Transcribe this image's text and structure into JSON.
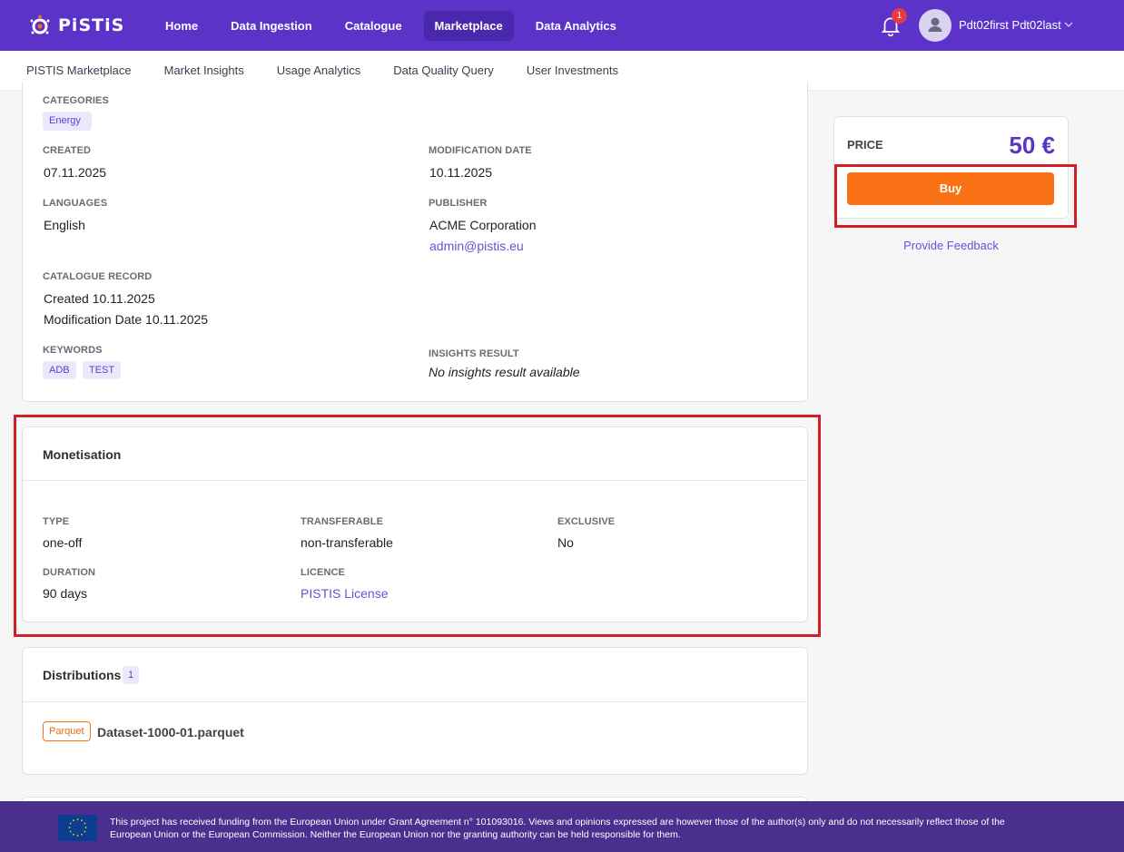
{
  "app": {
    "logo_text": "PiSTiS",
    "nav": [
      "Home",
      "Data Ingestion",
      "Catalogue",
      "Marketplace",
      "Data Analytics"
    ],
    "active_nav": "Marketplace",
    "notifications_count": "1",
    "username": "Pdt02first Pdt02last"
  },
  "subnav": [
    "PISTIS Marketplace",
    "Market Insights",
    "Usage Analytics",
    "Data Quality Query",
    "User Investments"
  ],
  "details": {
    "categories_label": "CATEGORIES",
    "categories": [
      "Energy"
    ],
    "created_label": "CREATED",
    "created": "07.11.2025",
    "modification_label": "MODIFICATION DATE",
    "modification": "10.11.2025",
    "languages_label": "LANGUAGES",
    "languages": "English",
    "publisher_label": "PUBLISHER",
    "publisher": "ACME Corporation",
    "publisher_email": "admin@pistis.eu",
    "catalogue_label": "CATALOGUE RECORD",
    "catalogue_created": "Created 10.11.2025",
    "catalogue_modified": "Modification Date 10.11.2025",
    "keywords_label": "KEYWORDS",
    "keywords": [
      "ADB",
      "TEST"
    ],
    "insights_label": "INSIGHTS RESULT",
    "insights": "No insights result available"
  },
  "monetisation": {
    "title": "Monetisation",
    "type_label": "TYPE",
    "type": "one-off",
    "transferable_label": "TRANSFERABLE",
    "transferable": "non-transferable",
    "exclusive_label": "EXCLUSIVE",
    "exclusive": "No",
    "duration_label": "DURATION",
    "duration": "90 days",
    "licence_label": "LICENCE",
    "licence": "PISTIS License"
  },
  "distributions": {
    "title": "Distributions",
    "count": "1",
    "items": [
      {
        "format": "Parquet",
        "name": "Dataset-1000-01.parquet"
      }
    ]
  },
  "price": {
    "label": "PRICE",
    "value": "50 €",
    "buy_label": "Buy",
    "feedback_label": "Provide Feedback"
  },
  "footer": {
    "text": "This project has received funding from the European Union under Grant Agreement n° 101093016. Views and opinions expressed are however those of the author(s) only and do not necessarily reflect those of the European Union or the European Commission. Neither the European Union nor the granting authority can be held responsible for them."
  },
  "colors": {
    "primary": "#5b33c9",
    "accent": "#f97316",
    "highlight": "#d21f26"
  }
}
